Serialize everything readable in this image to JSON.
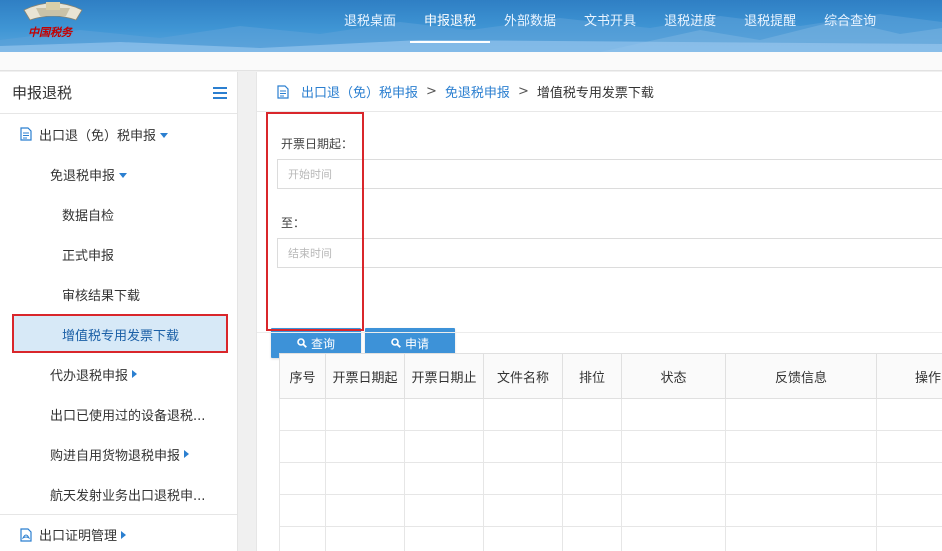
{
  "header": {
    "logo_text": "中国税务",
    "nav": [
      {
        "label": "退税桌面"
      },
      {
        "label": "申报退税",
        "active": true
      },
      {
        "label": "外部数据"
      },
      {
        "label": "文书开具"
      },
      {
        "label": "退税进度"
      },
      {
        "label": "退税提醒"
      },
      {
        "label": "综合查询"
      }
    ]
  },
  "sidebar": {
    "title": "申报退税",
    "items": [
      {
        "label": "出口退（免）税申报",
        "level": 1,
        "icon": "document-icon",
        "caret": "down"
      },
      {
        "label": "免退税申报",
        "level": 2,
        "caret": "down"
      },
      {
        "label": "数据自检",
        "level": 3
      },
      {
        "label": "正式申报",
        "level": 3
      },
      {
        "label": "审核结果下载",
        "level": 3
      },
      {
        "label": "增值税专用发票下载",
        "level": 3,
        "selected": true
      },
      {
        "label": "代办退税申报",
        "level": 2,
        "caret": "right"
      },
      {
        "label": "出口已使用过的设备退税...",
        "level": 2
      },
      {
        "label": "购进自用货物退税申报",
        "level": 2,
        "caret": "right"
      },
      {
        "label": "航天发射业务出口退税申...",
        "level": 2
      },
      {
        "label": "出口证明管理",
        "level": 1,
        "icon": "pdf-document-icon",
        "caret": "right"
      }
    ]
  },
  "breadcrumb": {
    "items": [
      "出口退（免）税申报",
      "免退税申报"
    ],
    "separator": ">",
    "current": "增值税专用发票下载"
  },
  "form": {
    "start_label": "开票日期起：",
    "start_placeholder": "开始时间",
    "end_label": "至：",
    "end_placeholder": "结束时间",
    "query_button": "查询",
    "apply_button": "申请"
  },
  "table": {
    "columns": [
      "序号",
      "开票日期起",
      "开票日期止",
      "文件名称",
      "排位",
      "状态",
      "反馈信息",
      "操作"
    ],
    "rows": []
  },
  "colors": {
    "accent": "#3d92d8",
    "highlight_border": "#d9262b",
    "selected_bg": "#d7e9f7"
  }
}
